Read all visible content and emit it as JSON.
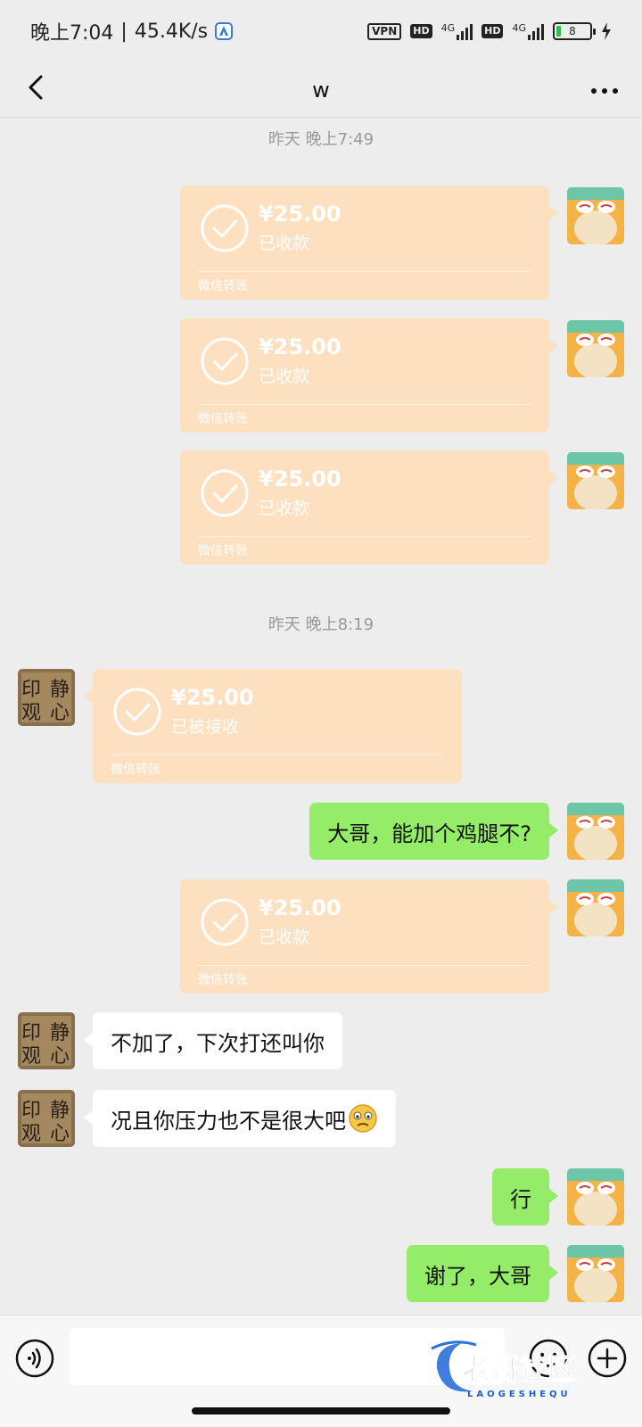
{
  "status_bar": {
    "time": "晚上7:04",
    "speed": "45.4K/s",
    "vpn": "VPN",
    "hd1": "HD",
    "hd2": "HD",
    "net1": "4G",
    "net2": "4G",
    "battery": "8"
  },
  "header": {
    "title": "w"
  },
  "timestamps": [
    "昨天 晚上7:49",
    "昨天 晚上8:19"
  ],
  "messages": [
    {
      "type": "transfer",
      "side": "right",
      "amount": "¥25.00",
      "status": "已收款",
      "footer": "微信转账"
    },
    {
      "type": "transfer",
      "side": "right",
      "amount": "¥25.00",
      "status": "已收款",
      "footer": "微信转账"
    },
    {
      "type": "transfer",
      "side": "right",
      "amount": "¥25.00",
      "status": "已收款",
      "footer": "微信转账"
    },
    {
      "type": "transfer",
      "side": "left",
      "amount": "¥25.00",
      "status": "已被接收",
      "footer": "微信转账"
    },
    {
      "type": "text",
      "side": "right",
      "text": "大哥，能加个鸡腿不?"
    },
    {
      "type": "transfer",
      "side": "right",
      "amount": "¥25.00",
      "status": "已收款",
      "footer": "微信转账"
    },
    {
      "type": "text",
      "side": "left",
      "text": "不加了，下次打还叫你"
    },
    {
      "type": "text",
      "side": "left",
      "text": "况且你压力也不是很大吧",
      "emoji": "slightly-frowning-emoji"
    },
    {
      "type": "text",
      "side": "right",
      "text": "行"
    },
    {
      "type": "text",
      "side": "right",
      "text": "谢了，大哥"
    }
  ],
  "avatar_left": {
    "calligraphy": [
      "静",
      "心",
      "印",
      "观"
    ]
  },
  "watermark": {
    "main": "老哥社区",
    "sub": "LAOGESHEQU"
  },
  "colors": {
    "green_bubble": "#95ec69",
    "transfer_bubble": "#fde0c0",
    "background": "#ededed"
  }
}
